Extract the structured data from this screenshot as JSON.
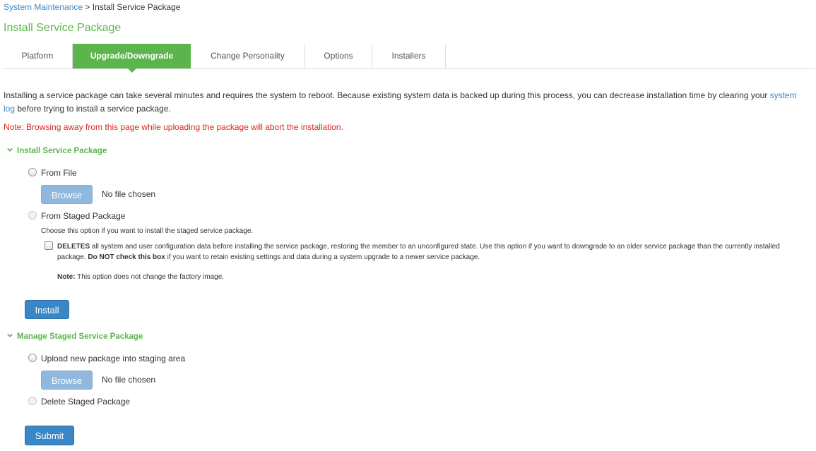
{
  "breadcrumb": {
    "parent": "System Maintenance",
    "separator": " > ",
    "current": "Install Service Package"
  },
  "page_title": "Install Service Package",
  "tabs": [
    {
      "label": "Platform",
      "active": false
    },
    {
      "label": "Upgrade/Downgrade",
      "active": true
    },
    {
      "label": "Change Personality",
      "active": false
    },
    {
      "label": "Options",
      "active": false
    },
    {
      "label": "Installers",
      "active": false
    }
  ],
  "intro": {
    "before_link": "Installing a service package can take several minutes and requires the system to reboot. Because existing system data is backed up during this process, you can decrease installation time by clearing your ",
    "link": "system log",
    "after_link": " before trying to install a service package."
  },
  "note": "Note: Browsing away from this page while uploading the package will abort the installation.",
  "install_section": {
    "title": "Install Service Package",
    "from_file_label": "From File",
    "browse_label": "Browse",
    "no_file_text": "No file chosen",
    "from_staged_label": "From Staged Package",
    "staged_help": "Choose this option if you want to install the staged service package.",
    "deletes_bold": "DELETES",
    "deletes_text": " all system and user configuration data before installing the service package, restoring the member to an unconfigured state. Use this option if you want to downgrade to an older service package than the currently installed package. ",
    "do_not_bold": "Do NOT check this box",
    "do_not_text": " if you want to retain existing settings and data during a system upgrade to a newer service package.",
    "option_note_bold": "Note:",
    "option_note_text": " This option does not change the factory image.",
    "install_button": "Install"
  },
  "manage_section": {
    "title": "Manage Staged Service Package",
    "upload_label": "Upload new package into staging area",
    "browse_label": "Browse",
    "no_file_text": "No file chosen",
    "delete_label": "Delete Staged Package",
    "submit_button": "Submit"
  },
  "colors": {
    "accent_green": "#5bb54c",
    "link_blue": "#3a87c8",
    "note_red": "#d9281f",
    "button_blue": "#3a87c8"
  },
  "icons": {
    "section_toggle": "chevron-down-icon"
  }
}
